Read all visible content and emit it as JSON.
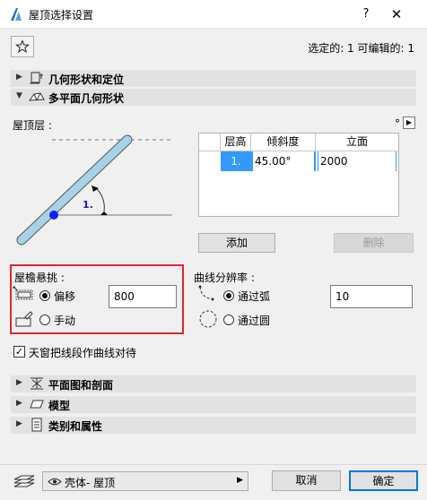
{
  "window": {
    "title": "屋顶选择设置",
    "help": "?",
    "close": "✕"
  },
  "selection_info": "选定的: 1 可编辑的: 1",
  "sections": {
    "geometry_position": "几何形状和定位",
    "multiplane_geometry": "多平面几何形状",
    "floor_plan_section": "平面图和剖面",
    "model": "模型",
    "category_props": "类别和属性"
  },
  "roof_levels": {
    "label": "屋顶层 :",
    "degree_symbol": "°",
    "diagram_label": "1.",
    "table": {
      "headers": [
        "层高",
        "倾斜度",
        "立面"
      ],
      "rows": [
        {
          "level": "1.",
          "pitch": "45.00°",
          "elevation": "2000"
        }
      ]
    },
    "add_button": "添加",
    "delete_button": "删除"
  },
  "eaves": {
    "label": "屋檐悬挑 :",
    "offset_label": "偏移",
    "offset_value": "800",
    "manual_label": "手动",
    "selected": "offset"
  },
  "curve": {
    "label": "曲线分辨率 :",
    "by_arc_label": "通过弧",
    "by_arc_value": "10",
    "by_circle_label": "通过圆",
    "selected": "arc"
  },
  "skylight_checkbox": {
    "label": "天窗把线段作曲线对待",
    "checked": true
  },
  "footer": {
    "layer_value": "壳体- 屋顶",
    "cancel_button": "取消",
    "ok_button": "确定"
  },
  "colors": {
    "highlight_red": "#e0242f",
    "row_selected_blue": "#3399ff",
    "diagram_beam": "#a6d3e6",
    "diagram_dot": "#1a1aff"
  }
}
